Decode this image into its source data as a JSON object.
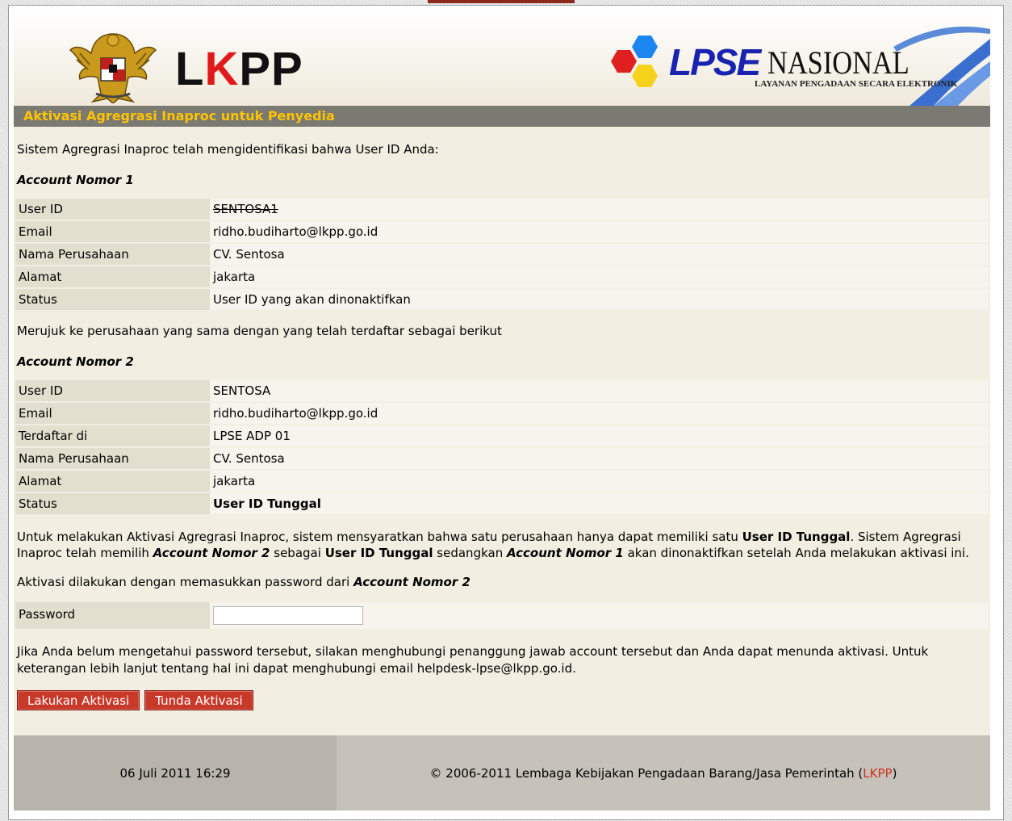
{
  "header": {
    "lkpp_logo_prefix": "L",
    "lkpp_logo_red": "K",
    "lkpp_logo_suffix": "PP",
    "lpse_logo_main": "LPSE",
    "lpse_logo_nasional": "NASIONAL",
    "lpse_logo_subtitle": "LAYANAN PENGADAAN SECARA ELEKTRONIK"
  },
  "title": "Aktivasi Agregrasi Inaproc untuk Penyedia",
  "intro": "Sistem Agregrasi Inaproc telah mengidentifikasi bahwa User ID Anda:",
  "account1": {
    "heading": "Account Nomor 1",
    "rows": [
      {
        "label": "User ID",
        "value": "SENTOSA1"
      },
      {
        "label": "Email",
        "value": "ridho.budiharto@lkpp.go.id"
      },
      {
        "label": "Nama Perusahaan",
        "value": "CV. Sentosa"
      },
      {
        "label": "Alamat",
        "value": "jakarta"
      },
      {
        "label": "Status",
        "value": "User ID yang akan dinonaktifkan"
      }
    ]
  },
  "refer_text": "Merujuk ke perusahaan yang sama dengan yang telah terdaftar sebagai berikut",
  "account2": {
    "heading": "Account Nomor 2",
    "rows": [
      {
        "label": "User ID",
        "value": "SENTOSA"
      },
      {
        "label": "Email",
        "value": "ridho.budiharto@lkpp.go.id"
      },
      {
        "label": "Terdaftar di",
        "value": "LPSE ADP 01"
      },
      {
        "label": "Nama Perusahaan",
        "value": "CV. Sentosa"
      },
      {
        "label": "Alamat",
        "value": "jakarta"
      },
      {
        "label": "Status",
        "value": "User ID Tunggal"
      }
    ]
  },
  "explain": {
    "p1": "Untuk melakukan Aktivasi Agregrasi Inaproc, sistem mensyaratkan bahwa satu perusahaan hanya dapat memiliki satu ",
    "b1": "User ID Tunggal",
    "p2": ". Sistem Agregrasi Inaproc telah memilih ",
    "bi1": "Account Nomor 2",
    "p3": " sebagai ",
    "b2": "User ID Tunggal",
    "p4": " sedangkan ",
    "bi2": "Account Nomor 1",
    "p5": " akan dinonaktifkan setelah Anda melakukan aktivasi ini."
  },
  "activation_note": {
    "text": "Aktivasi dilakukan dengan memasukkan password dari ",
    "account": "Account Nomor 2"
  },
  "password": {
    "label": "Password",
    "value": ""
  },
  "help_text": "Jika Anda belum mengetahui password tersebut, silakan menghubungi penanggung jawab account tersebut dan Anda dapat menunda aktivasi. Untuk keterangan lebih lanjut tentang hal ini dapat menghubungi email helpdesk-lpse@lkpp.go.id.",
  "buttons": {
    "activate": "Lakukan Aktivasi",
    "postpone": "Tunda Aktivasi"
  },
  "footer": {
    "datetime": "06 Juli 2011 16:29",
    "copyright": "© 2006-2011 Lembaga Kebijakan Pengadaan Barang/Jasa Pemerintah (",
    "link": "LKPP",
    "close": ")"
  },
  "colors": {
    "title_bar": "#7a7a72",
    "title_text": "#ffc400",
    "button": "#c8392a",
    "lpse_blue": "#1a23b0",
    "lkpp_red": "#e01a1a"
  }
}
